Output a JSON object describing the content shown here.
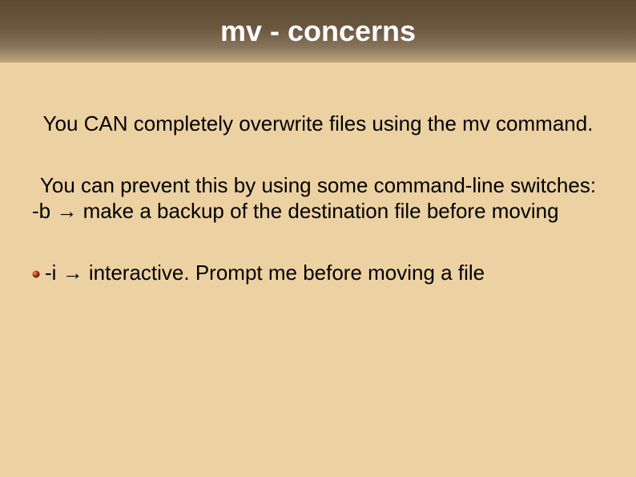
{
  "title": "mv - concerns",
  "p1": "You CAN completely overwrite files using the mv command.",
  "p2a": "You can prevent this by using some command-line switches:",
  "p2b": "-b → make a backup of the destination file before moving",
  "p3": "-i → interactive. Prompt me before moving a file"
}
